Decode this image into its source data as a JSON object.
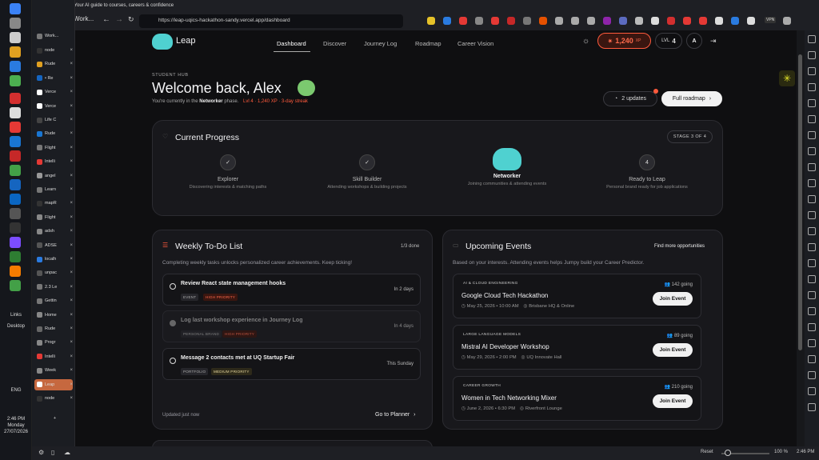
{
  "browser": {
    "tab_title": "Leap — Your AI guide to courses, careers & confidence",
    "url": "https://leap-uqics-hackathon-sandy.vercel.app/dashboard",
    "workspace": "Work...",
    "zoom": "100 %",
    "reset": "Reset",
    "clock": "2:46 PM",
    "vpn": "VPN"
  },
  "sidebar_tabs": [
    {
      "label": "node"
    },
    {
      "label": "Rude"
    },
    {
      "label": "• Re"
    },
    {
      "label": "Verce"
    },
    {
      "label": "Verce"
    },
    {
      "label": "Life C"
    },
    {
      "label": "Rude"
    },
    {
      "label": "Flight"
    },
    {
      "label": "Intelli"
    },
    {
      "label": "angel"
    },
    {
      "label": "Learn"
    },
    {
      "label": "mapR"
    },
    {
      "label": "Flight"
    },
    {
      "label": "adsh"
    },
    {
      "label": "ADSE"
    },
    {
      "label": "localh"
    },
    {
      "label": "unpac"
    },
    {
      "label": "2.3 Le"
    },
    {
      "label": "Gettin"
    },
    {
      "label": "Home"
    },
    {
      "label": "Rude"
    },
    {
      "label": "Progr"
    },
    {
      "label": "Intelli"
    },
    {
      "label": "Week"
    },
    {
      "label": "Leap"
    },
    {
      "label": "node"
    }
  ],
  "taskbar": {
    "links": "Links",
    "desktop": "Desktop",
    "lang": "ENG",
    "time": "2:46 PM",
    "day": "Monday",
    "date": "27/07/2026"
  },
  "app": {
    "brand": "Leap",
    "nav": [
      "Dashboard",
      "Discover",
      "Journey Log",
      "Roadmap",
      "Career Vision"
    ],
    "xp": "1,240",
    "xp_unit": "XP",
    "level_label": "LVL",
    "level": "4",
    "avatar": "A"
  },
  "hero": {
    "eyebrow": "STUDENT HUB",
    "title": "Welcome back, Alex",
    "phase_prefix": "You're currently in the",
    "phase": "Networker",
    "phase_suffix": "phase.",
    "stats": "Lvl 4 · 1,240 XP · 3-day streak",
    "updates_btn": "2 updates",
    "roadmap_btn": "Full roadmap"
  },
  "progress": {
    "title": "Current Progress",
    "stage_badge": "STAGE 3 OF 4",
    "stages": [
      {
        "name": "Explorer",
        "desc": "Discovering interests & matching paths",
        "mark": "✓"
      },
      {
        "name": "Skill Builder",
        "desc": "Attending workshops & building projects",
        "mark": "✓"
      },
      {
        "name": "Networker",
        "desc": "Joining communities & attending events",
        "mark": ""
      },
      {
        "name": "Ready to Leap",
        "desc": "Personal brand ready for job applications",
        "mark": "4"
      }
    ]
  },
  "todo": {
    "title": "Weekly To-Do List",
    "count": "1/3 done",
    "subtitle": "Completing weekly tasks unlocks personalized career achievements. Keep ticking!",
    "items": [
      {
        "title": "Review React state management hooks",
        "due": "In 2 days",
        "tag1": "EVENT",
        "tag2": "HIGH PRIORITY"
      },
      {
        "title": "Log last workshop experience in Journey Log",
        "due": "In 4 days",
        "tag1": "PERSONAL BRAND",
        "tag2": "HIGH PRIORITY"
      },
      {
        "title": "Message 2 contacts met at UQ Startup Fair",
        "due": "This Sunday",
        "tag1": "PORTFOLIO",
        "tag2": "MEDIUM PRIORITY"
      }
    ],
    "updated": "Updated just now",
    "planner": "Go to Planner"
  },
  "events": {
    "title": "Upcoming Events",
    "more": "Find more opportunities",
    "subtitle": "Based on your interests. Attending events helps Jumpy build your Career Predictor.",
    "join": "Join Event",
    "items": [
      {
        "category": "AI & CLOUD ENGINEERING",
        "title": "Google Cloud Tech Hackathon",
        "date": "May 25, 2026 • 10:00 AM",
        "place": "Brisbane HQ & Online",
        "going": "142 going"
      },
      {
        "category": "LARGE LANGUAGE MODELS",
        "title": "Mistral AI Developer Workshop",
        "date": "May 29, 2026 • 2:00 PM",
        "place": "UQ Innovate Hall",
        "going": "89 going"
      },
      {
        "category": "CAREER GROWTH",
        "title": "Women in Tech Networking Mixer",
        "date": "June 2, 2026 • 6:30 PM",
        "place": "Riverfront Lounge",
        "going": "210 going"
      }
    ]
  },
  "colors": {
    "accent": "#ff5a3c",
    "bg": "#0f0f11",
    "card": "#18181c",
    "teal": "#4fd1d0"
  }
}
